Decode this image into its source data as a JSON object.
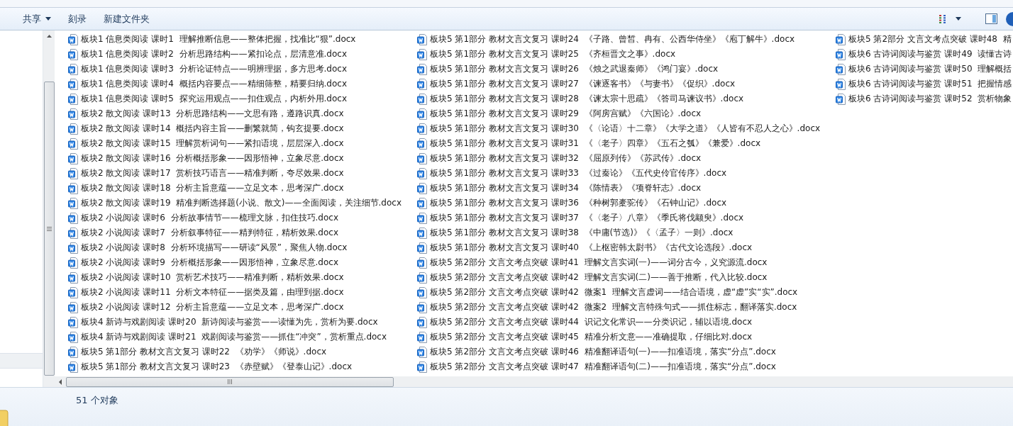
{
  "toolbar": {
    "items": [
      {
        "label": "共享",
        "kind": "menu"
      },
      {
        "label": "刻录",
        "kind": "button"
      },
      {
        "label": "新建文件夹",
        "kind": "button"
      }
    ]
  },
  "files": {
    "columns": [
      [
        {
          "name": "板块1 信息类阅读 课时1  理解推断信息——整体把握，找准比“狠”.docx"
        },
        {
          "name": "板块1 信息类阅读 课时2  分析思路结构——紧扣论点，层清意准.docx"
        },
        {
          "name": "板块1 信息类阅读 课时3  分析论证特点——明辨理据，多方思考.docx"
        },
        {
          "name": "板块1 信息类阅读 课时4  概括内容要点——精细筛整，精要归纳.docx"
        },
        {
          "name": "板块1 信息类阅读 课时5  探究运用观点——扣住观点，内析外用.docx"
        },
        {
          "name": "板块2 散文阅读 课时13  分析思路结构——文思有路，遵路识真.docx"
        },
        {
          "name": "板块2 散文阅读 课时14  概括内容主旨——删繁就简，钩玄提要.docx"
        },
        {
          "name": "板块2 散文阅读 课时15  理解赏析词句——紧扣语境，层层深入.docx"
        },
        {
          "name": "板块2 散文阅读 课时16  分析概括形象——因形悟神，立象尽意.docx"
        },
        {
          "name": "板块2 散文阅读 课时17  赏析技巧语言——精准判断，夸尽效果.docx"
        },
        {
          "name": "板块2 散文阅读 课时18  分析主旨意蕴——立足文本，思考深广.docx"
        },
        {
          "name": "板块2 散文阅读 课时19  精准判断选择题(小说、散文)——全面阅读，关注细节.docx"
        },
        {
          "name": "板块2 小说阅读 课时6  分析故事情节——梳理文脉，扣住技巧.docx"
        },
        {
          "name": "板块2 小说阅读 课时7  分析叙事特征——精判特征，精析效果.docx"
        },
        {
          "name": "板块2 小说阅读 课时8  分析环境描写——研读“风景”，聚焦人物.docx"
        },
        {
          "name": "板块2 小说阅读 课时9  分析概括形象——因形悟神，立象尽意.docx"
        },
        {
          "name": "板块2 小说阅读 课时10  赏析艺术技巧——精准判断，精析效果.docx"
        },
        {
          "name": "板块2 小说阅读 课时11  分析文本特征——据类及篇，由理到据.docx"
        },
        {
          "name": "板块2 小说阅读 课时12  分析主旨意蕴——立足文本，思考深广.docx"
        },
        {
          "name": "板块4 新诗与戏剧阅读 课时20  新诗阅读与鉴赏——读懂为先，赏析为要.docx"
        },
        {
          "name": "板块4 新诗与戏剧阅读 课时21  戏剧阅读与鉴赏——抓住“冲突”，赏析重点.docx"
        },
        {
          "name": "板块5 第1部分 教材文言文复习 课时22  《劝学》《师说》.docx"
        },
        {
          "name": "板块5 第1部分 教材文言文复习 课时23  《赤壁赋》《登泰山记》.docx"
        }
      ],
      [
        {
          "name": "板块5 第1部分 教材文言文复习 课时24  《子路、曾皙、冉有、公西华侍坐》《庖丁解牛》.docx"
        },
        {
          "name": "板块5 第1部分 教材文言文复习 课时25  《齐桓晋文之事》.docx"
        },
        {
          "name": "板块5 第1部分 教材文言文复习 课时26  《烛之武退秦师》《鸿门宴》.docx"
        },
        {
          "name": "板块5 第1部分 教材文言文复习 课时27  《谏逐客书》《与妻书》《促织》.docx"
        },
        {
          "name": "板块5 第1部分 教材文言文复习 课时28  《谏太宗十思疏》《答司马谏议书》.docx"
        },
        {
          "name": "板块5 第1部分 教材文言文复习 课时29  《阿房宫赋》《六国论》.docx"
        },
        {
          "name": "板块5 第1部分 教材文言文复习 课时30  《〈论语〉十二章》《大学之道》《人皆有不忍人之心》.docx"
        },
        {
          "name": "板块5 第1部分 教材文言文复习 课时31  《〈老子〉四章》《五石之瓠》《兼爱》.docx"
        },
        {
          "name": "板块5 第1部分 教材文言文复习 课时32  《屈原列传》《苏武传》.docx"
        },
        {
          "name": "板块5 第1部分 教材文言文复习 课时33  《过秦论》《五代史伶官传序》.docx"
        },
        {
          "name": "板块5 第1部分 教材文言文复习 课时34  《陈情表》《项脊轩志》.docx"
        },
        {
          "name": "板块5 第1部分 教材文言文复习 课时36  《种树郭橐驼传》《石钟山记》.docx"
        },
        {
          "name": "板块5 第1部分 教材文言文复习 课时37  《〈老子〉八章》《季氏将伐颛臾》.docx"
        },
        {
          "name": "板块5 第1部分 教材文言文复习 课时38  《中庸(节选)》《〈孟子〉一则》.docx"
        },
        {
          "name": "板块5 第1部分 教材文言文复习 课时40  《上枢密韩太尉书》《古代文论选段》.docx"
        },
        {
          "name": "板块5 第2部分 文言文考点突破 课时41  理解文言实词(一)——词分古今，义究源流.docx"
        },
        {
          "name": "板块5 第2部分 文言文考点突破 课时42  理解文言实词(二)——善于推断，代入比较.docx"
        },
        {
          "name": "板块5 第2部分 文言文考点突破 课时42  微案1  理解文言虚词——结合语境，虚“虚”实“实”.docx"
        },
        {
          "name": "板块5 第2部分 文言文考点突破 课时42  微案2  理解文言特殊句式——抓住标志，翻译落实.docx"
        },
        {
          "name": "板块5 第2部分 文言文考点突破 课时44  识记文化常识——分类识记，辅以语境.docx"
        },
        {
          "name": "板块5 第2部分 文言文考点突破 课时45  精准分析文意——准确提取，仔细比对.docx"
        },
        {
          "name": "板块5 第2部分 文言文考点突破 课时46  精准翻译语句(一)——扣准语境，落实“分点”.docx"
        },
        {
          "name": "板块5 第2部分 文言文考点突破 课时47  精准翻译语句(二)——扣准语境，落实“分点”.docx"
        }
      ],
      [
        {
          "name": "板块5 第2部分 文言文考点突破 课时48  精"
        },
        {
          "name": "板块6 古诗词阅读与鉴赏 课时49  读懂古诗"
        },
        {
          "name": "板块6 古诗词阅读与鉴赏 课时50  理解概括"
        },
        {
          "name": "板块6 古诗词阅读与鉴赏 课时51  把握情感"
        },
        {
          "name": "板块6 古诗词阅读与鉴赏 课时52  赏析物象"
        }
      ]
    ]
  },
  "status_bar": {
    "count": "51 个对象"
  }
}
